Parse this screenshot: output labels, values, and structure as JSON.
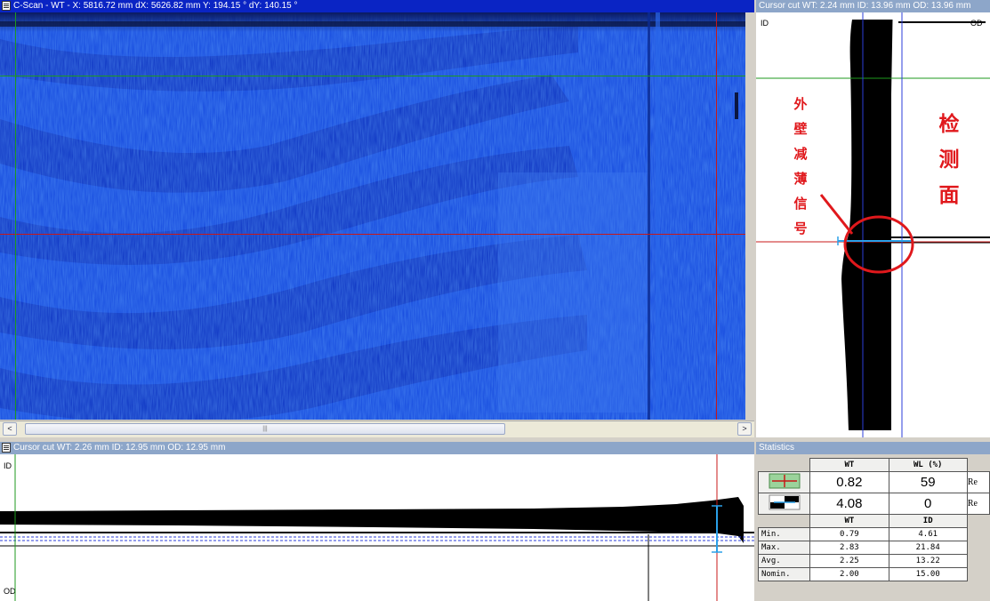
{
  "cscan": {
    "title": "C-Scan - WT  -  X: 5816.72 mm  dX: 5626.82 mm    Y: 194.15 °  dY: 140.15 °",
    "scroll_left": "<",
    "scroll_right": ">",
    "scroll_thumb": "|||"
  },
  "cursor_cut_right": {
    "title": "Cursor cut  WT: 2.24 mm  ID: 13.96 mm  OD: 13.96 mm",
    "id_label": "ID",
    "od_label": "OD",
    "annotation_outer": [
      "外",
      "壁",
      "减",
      "薄",
      "信",
      "号"
    ],
    "annotation_surface": [
      "检",
      "测",
      "面"
    ]
  },
  "cursor_cut_bottom": {
    "title": "Cursor cut  WT: 2.26 mm  ID: 12.95 mm  OD: 12.95 mm",
    "id_label": "ID",
    "od_label": "OD"
  },
  "statistics": {
    "title": "Statistics",
    "top_headers": [
      "WT",
      "WL (%)"
    ],
    "cursor_row": [
      "0.82",
      "59"
    ],
    "ref_row": [
      "4.08",
      "0"
    ],
    "side_buttons": [
      "Re",
      "Re"
    ],
    "table_headers": [
      "WT",
      "ID"
    ],
    "rows": [
      {
        "label": "Min.",
        "wt": "0.79",
        "id": "4.61"
      },
      {
        "label": "Max.",
        "wt": "2.83",
        "id": "21.84"
      },
      {
        "label": "Avg.",
        "wt": "2.25",
        "id": "13.22"
      },
      {
        "label": "Nomin.",
        "wt": "2.00",
        "id": "15.00"
      }
    ]
  },
  "colors": {
    "scan_blue": "#1a4fe0",
    "cursor_green": "#1e9a1e",
    "cursor_red": "#c81818",
    "annotation_red": "#e0181c",
    "title_active": "#0a24c4",
    "title_inactive": "#8da6c9"
  }
}
